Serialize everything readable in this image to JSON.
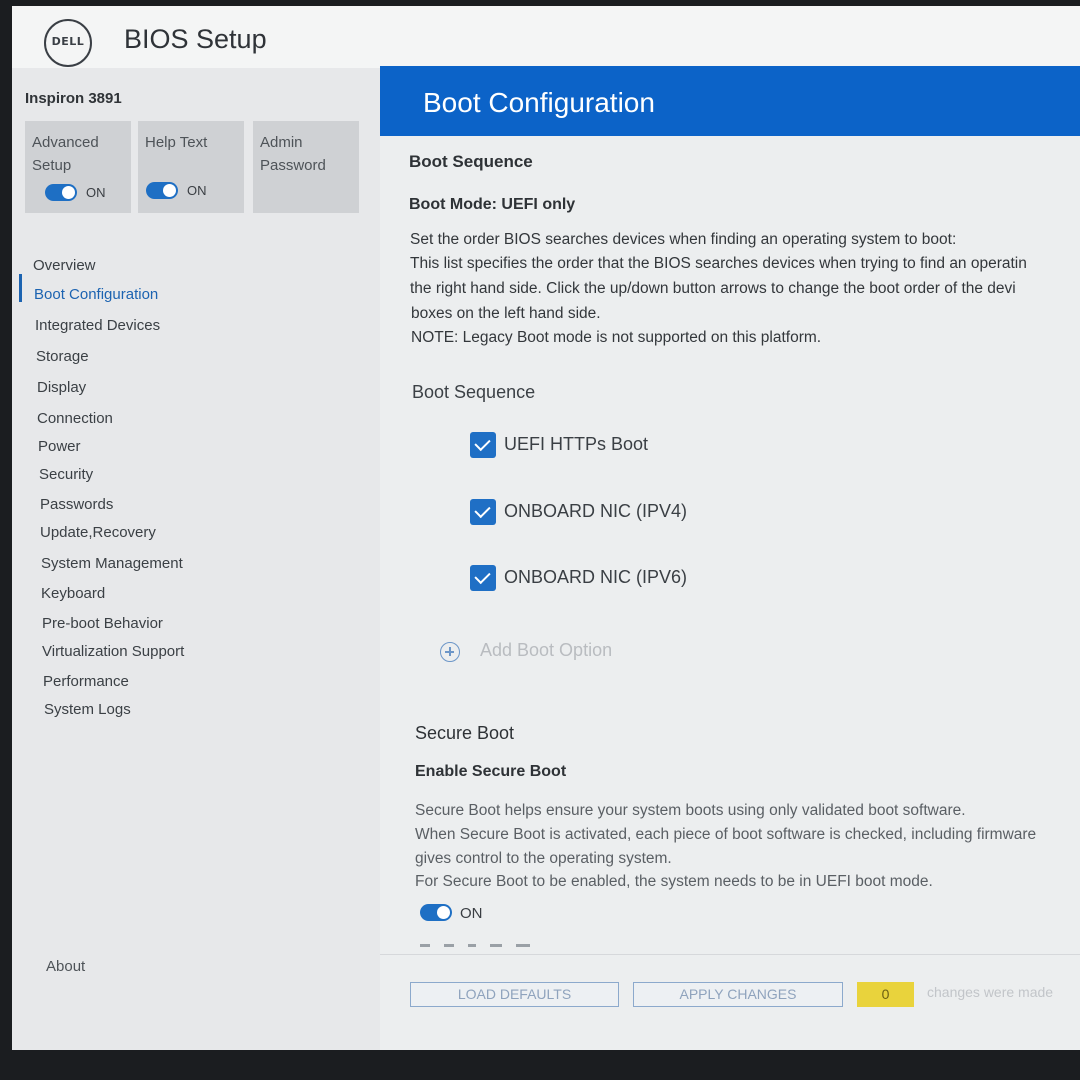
{
  "header": {
    "logo_text": "DELL",
    "title": "BIOS Setup"
  },
  "sidebar": {
    "model": "Inspiron 3891",
    "tiles": {
      "advanced_setup": {
        "label": "Advanced Setup",
        "state": "ON"
      },
      "help_text": {
        "label": "Help Text",
        "state": "ON"
      },
      "admin_password": {
        "label": "Admin Password"
      }
    },
    "items": [
      "Overview",
      "Boot Configuration",
      "Integrated Devices",
      "Storage",
      "Display",
      "Connection",
      "Power",
      "Security",
      "Passwords",
      "Update,Recovery",
      "System Management",
      "Keyboard",
      "Pre-boot Behavior",
      "Virtualization Support",
      "Performance",
      "System Logs"
    ],
    "active_item": "Boot Configuration",
    "about": "About"
  },
  "main": {
    "title": "Boot Configuration",
    "boot_sequence_heading": "Boot Sequence",
    "boot_mode": "Boot Mode: UEFI only",
    "description": [
      "Set the order BIOS searches devices when finding an operating system to boot:",
      "This list specifies the order that the BIOS searches devices when trying to find an operatin",
      "the right hand side.  Click the up/down button arrows to change the boot order of the devi",
      "boxes on the left hand side.",
      "NOTE: Legacy Boot mode is not supported on this platform."
    ],
    "boot_sequence_label": "Boot Sequence",
    "boot_options": [
      {
        "label": "UEFI HTTPs Boot",
        "checked": true
      },
      {
        "label": "ONBOARD NIC (IPV4)",
        "checked": true
      },
      {
        "label": "ONBOARD NIC (IPV6)",
        "checked": true
      }
    ],
    "add_boot_option": "Add Boot Option",
    "secure_boot": {
      "heading": "Secure Boot",
      "subheading": "Enable Secure Boot",
      "description": [
        "Secure Boot helps ensure your system boots using only validated boot software.",
        "When Secure Boot is activated, each piece of boot software is checked, including firmware",
        "gives control to the operating system.",
        "For Secure Boot to be enabled, the system needs to be in UEFI boot mode."
      ],
      "toggle_state": "ON"
    }
  },
  "footer": {
    "load_defaults": "LOAD DEFAULTS",
    "apply_changes": "APPLY CHANGES",
    "change_count": "0",
    "changes_text": "changes were made"
  },
  "colors": {
    "accent": "#0c63c8",
    "toggle_on": "#1e6fc4",
    "badge": "#e9d33c"
  }
}
